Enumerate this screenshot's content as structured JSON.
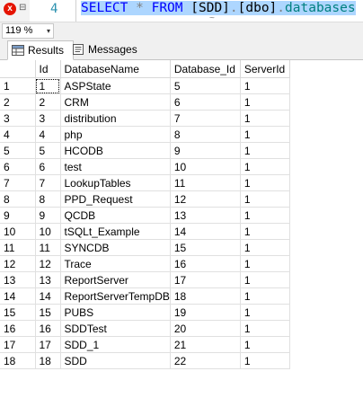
{
  "editor": {
    "line_number": "4",
    "error_mark": "x",
    "collapse_icon": "chevron-down-icon",
    "sql": {
      "select": "SELECT",
      "star": "*",
      "from": "FROM",
      "db_bracket": "[SDD]",
      "dot1": ".",
      "schema": "[dbo]",
      "dot2": ".",
      "table": "databases"
    },
    "squiggle": "~"
  },
  "zoom": {
    "value": "119 %",
    "arrow": "▾"
  },
  "tabs": [
    {
      "label": "Results",
      "icon": "grid-icon",
      "active": true
    },
    {
      "label": "Messages",
      "icon": "messages-icon",
      "active": false
    }
  ],
  "grid": {
    "columns": [
      "",
      "Id",
      "DatabaseName",
      "Database_Id",
      "ServerId"
    ],
    "rows": [
      [
        "1",
        "1",
        "ASPState",
        "5",
        "1"
      ],
      [
        "2",
        "2",
        "CRM",
        "6",
        "1"
      ],
      [
        "3",
        "3",
        "distribution",
        "7",
        "1"
      ],
      [
        "4",
        "4",
        "php",
        "8",
        "1"
      ],
      [
        "5",
        "5",
        "HCODB",
        "9",
        "1"
      ],
      [
        "6",
        "6",
        "test",
        "10",
        "1"
      ],
      [
        "7",
        "7",
        "LookupTables",
        "11",
        "1"
      ],
      [
        "8",
        "8",
        "PPD_Request",
        "12",
        "1"
      ],
      [
        "9",
        "9",
        "QCDB",
        "13",
        "1"
      ],
      [
        "10",
        "10",
        "tSQLt_Example",
        "14",
        "1"
      ],
      [
        "11",
        "11",
        "SYNCDB",
        "15",
        "1"
      ],
      [
        "12",
        "12",
        "Trace",
        "16",
        "1"
      ],
      [
        "13",
        "13",
        "ReportServer",
        "17",
        "1"
      ],
      [
        "14",
        "14",
        "ReportServerTempDB",
        "18",
        "1"
      ],
      [
        "15",
        "15",
        "PUBS",
        "19",
        "1"
      ],
      [
        "16",
        "16",
        "SDDTest",
        "20",
        "1"
      ],
      [
        "17",
        "17",
        "SDD_1",
        "21",
        "1"
      ],
      [
        "18",
        "18",
        "SDD",
        "22",
        "1"
      ]
    ]
  }
}
